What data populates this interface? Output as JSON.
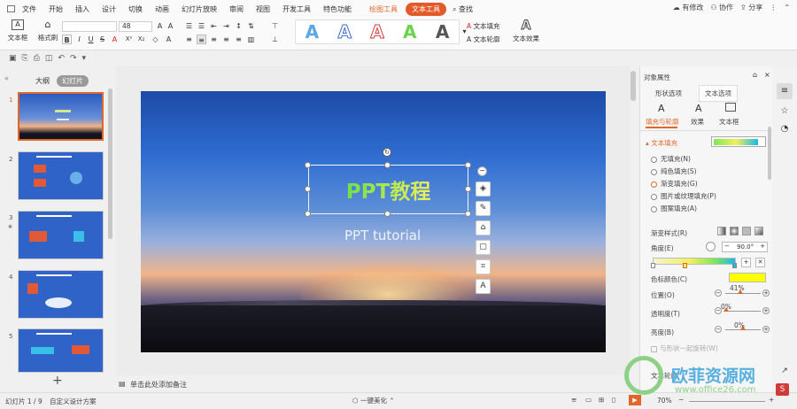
{
  "menubar": {
    "items": [
      "文件",
      "开始",
      "插入",
      "设计",
      "切换",
      "动画",
      "幻灯片放映",
      "审阅",
      "视图",
      "开发工具",
      "特色功能"
    ],
    "context_tab_drawing": "绘图工具",
    "context_tab_text": "文本工具",
    "search": "查找",
    "right": [
      "有修改",
      "协作",
      "分享"
    ]
  },
  "ribbon": {
    "textbox_label": "文本框",
    "format_painter": "格式刷",
    "font_size": "48",
    "format_buttons": [
      "B",
      "I",
      "U",
      "A",
      "X²",
      "X₂",
      "A"
    ],
    "wordart_letter": "A",
    "text_fill": "文本填充",
    "text_outline": "文本轮廓",
    "text_effect": "文本效果"
  },
  "left_pane": {
    "tab_outline": "大纲",
    "tab_slides": "幻灯片",
    "slide_numbers": [
      "1",
      "2",
      "3",
      "4",
      "5"
    ],
    "add_icon": "+"
  },
  "slide": {
    "title": "PPT教程",
    "subtitle": "PPT tutorial"
  },
  "notes_placeholder": "单击此处添加备注",
  "right_panel": {
    "header": "对象属性",
    "tab_shape": "形状选项",
    "tab_text": "文本选项",
    "sub_fill": "填充与轮廓",
    "sub_effect": "效果",
    "sub_textbox": "文本框",
    "section_fill": "文本填充",
    "fill_options": [
      "无填充(N)",
      "纯色填充(S)",
      "渐变填充(G)",
      "图片或纹理填充(P)",
      "图案填充(A)"
    ],
    "gradient_style": "渐变样式(R)",
    "angle_label": "角度(E)",
    "angle_value": "90.0°",
    "stop_color_label": "色标颜色(C)",
    "position_label": "位置(O)",
    "position_value": "41%",
    "transparency_label": "透明度(T)",
    "transparency_value": "0%",
    "brightness_label": "亮度(B)",
    "brightness_value": "0%",
    "rotate_with_shape": "与形状一起旋转(W)",
    "text_outline": "文本轮廓"
  },
  "status": {
    "slide_info": "幻灯片 1 / 9",
    "design": "自定义设计方案",
    "beautify": "一键美化",
    "zoom": "70%"
  },
  "watermark": {
    "cn": "欧菲资源网",
    "url": "www.office26.com"
  },
  "colors": {
    "accent": "#e0662a",
    "stop_color": "#ffff00",
    "gradient_start": "#7ee85a",
    "gradient_end": "#19b8e8"
  }
}
